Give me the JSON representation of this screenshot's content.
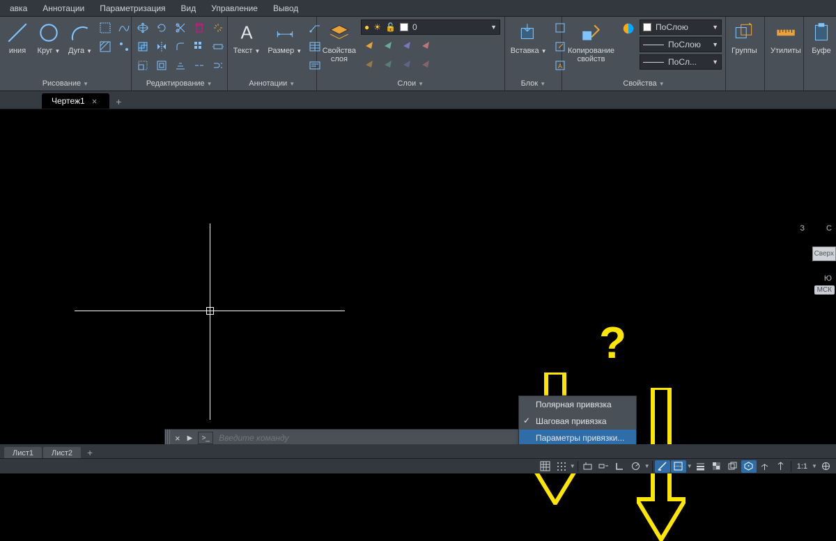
{
  "menu": {
    "items": [
      "авка",
      "Аннотации",
      "Параметризация",
      "Вид",
      "Управление",
      "Вывод"
    ]
  },
  "ribbon": {
    "draw": {
      "title": "Рисование",
      "line": "иния",
      "circle": "Круг",
      "arc": "Дуга"
    },
    "edit": {
      "title": "Редактирование"
    },
    "annot": {
      "title": "Аннотации",
      "text": "Текст",
      "dim": "Размер"
    },
    "layers": {
      "title": "Слои",
      "props": "Свойства\nслоя",
      "current": "0"
    },
    "block": {
      "title": "Блок",
      "insert": "Вставка",
      "copyprops": "Копирование\nсвойств"
    },
    "props": {
      "title": "Свойства",
      "bylayer": "ПоСлою",
      "byline1": "ПоСлою",
      "byline2": "ПоСл..."
    },
    "groups": {
      "title": "Группы"
    },
    "utils": {
      "title": "Утилиты"
    },
    "clip": {
      "title": "Буфе"
    }
  },
  "tabs": {
    "doc": "Чертеж1"
  },
  "viewcube": {
    "n": "С",
    "w": "З",
    "s": "Ю",
    "face": "Сверх",
    "wcs": "МСК"
  },
  "cmd": {
    "placeholder": "Введите команду"
  },
  "context": {
    "polar": "Полярная привязка",
    "step": "Шаговая привязка",
    "settings": "Параметры привязки..."
  },
  "layouts": {
    "l1": "Лист1",
    "l2": "Лист2"
  },
  "status": {
    "scale": "1:1"
  }
}
